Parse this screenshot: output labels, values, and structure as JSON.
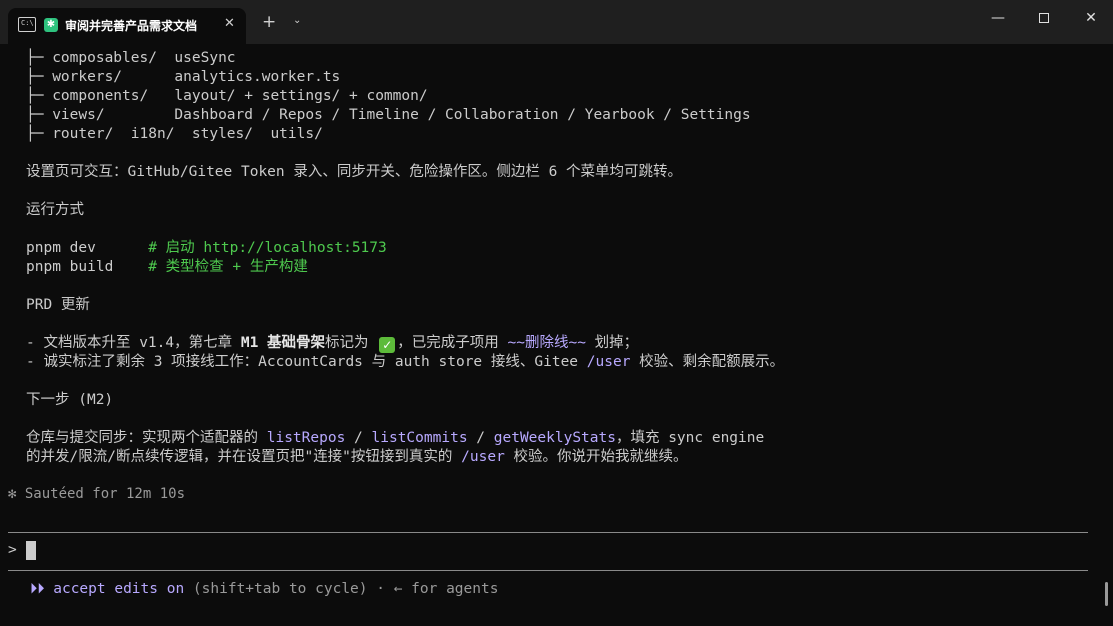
{
  "window": {
    "tab_title": "审阅并完善产品需求文档",
    "tab_close": "✕",
    "new_tab": "+",
    "tab_dropdown": "⌄",
    "term_icon_text": "C:\\",
    "app_icon": "✱",
    "minimize": "—",
    "close": "✕"
  },
  "tree": [
    {
      "prefix": "├─ ",
      "text": "composables/  useSync"
    },
    {
      "prefix": "├─ ",
      "text": "workers/      analytics.worker.ts"
    },
    {
      "prefix": "├─ ",
      "text": "components/   layout/ + settings/ + common/"
    },
    {
      "prefix": "├─ ",
      "text": "views/        Dashboard / Repos / Timeline / Collaboration / Yearbook / Settings"
    },
    {
      "prefix": "├─ ",
      "text": "router/  i18n/  styles/  utils/"
    }
  ],
  "settings_line": "设置页可交互：GitHub/Gitee Token 录入、同步开关、危险操作区。侧边栏 6 个菜单均可跳转。",
  "run_heading": "运行方式",
  "commands": [
    {
      "cmd": "pnpm dev      ",
      "comment": "# 启动 http://localhost:5173"
    },
    {
      "cmd": "pnpm build    ",
      "comment": "# 类型检查 + 生产构建"
    }
  ],
  "prd_heading": "PRD 更新",
  "prd_line1": {
    "a": "- 文档版本升至 v1.4，第七章 ",
    "b": "M1 基础骨架",
    "c": "标记为 ",
    "check": "✓",
    "d": "，已完成子项用 ",
    "e": "~~删除线~~",
    "f": " 划掉；"
  },
  "prd_line2": {
    "a": "- 诚实标注了剩余 3 项接线工作：AccountCards 与 auth store 接线、Gitee ",
    "b": "/user",
    "c": " 校验、剩余配额展示。"
  },
  "next_heading": "下一步 (M2)",
  "next_line1": {
    "a": "仓库与提交同步：实现两个适配器的 ",
    "b": "listRepos",
    "c": " / ",
    "d": "listCommits",
    "e": " / ",
    "f": "getWeeklyStats",
    "g": "，填充 sync engine"
  },
  "next_line2": {
    "a": "的并发/限流/断点续传逻辑，并在设置页把\"连接\"按钮接到真实的 ",
    "b": "/user",
    "c": " 校验。你说开始我就继续。"
  },
  "status": "✻ Sautéed for 12m 10s",
  "prompt_symbol": ">",
  "footer": {
    "arrows": "⏵⏵ ",
    "mode": "accept edits on",
    "hint": " (shift+tab to cycle) · ← for agents"
  }
}
